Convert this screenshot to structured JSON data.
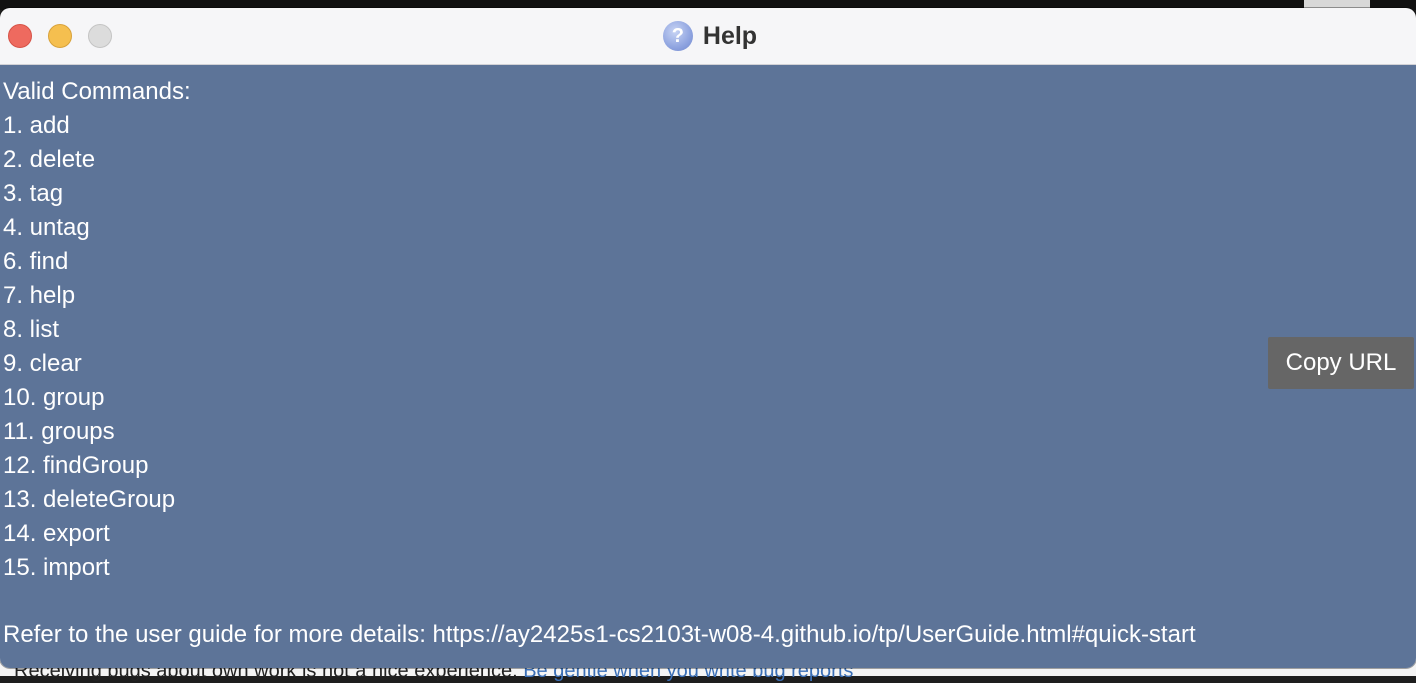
{
  "window": {
    "title": "Help",
    "icon": "help-question-icon"
  },
  "help": {
    "header": "Valid Commands:",
    "commands": [
      "1. add",
      "2. delete",
      "3. tag",
      "4. untag",
      "6. find",
      "7. help",
      "8. list",
      "9. clear",
      "10. group",
      "11. groups",
      "12. findGroup",
      "13. deleteGroup",
      "14. export",
      "15. import"
    ],
    "guide_text": "Refer to the user guide for more details: https://ay2425s1-cs2103t-w08-4.github.io/tp/UserGuide.html#quick-start",
    "copy_button_label": "Copy URL"
  },
  "background": {
    "partial_text": "Receiving bugs about own work is not a nice experience.",
    "partial_link": "Be gentle when you write bug reports"
  },
  "colors": {
    "content_bg": "#5d7498",
    "button_bg": "#666666",
    "close": "#ee6a5f",
    "minimize": "#f5bf4f",
    "zoom_disabled": "#dcdcdc"
  }
}
